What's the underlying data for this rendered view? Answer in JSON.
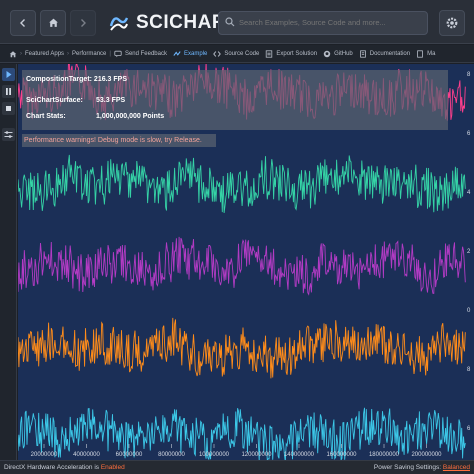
{
  "header": {
    "logo_text": "SCICHART",
    "search_placeholder": "Search Examples, Source Code and more..."
  },
  "breadcrumb": [
    {
      "label": "Featured Apps",
      "icon": "home-icon"
    },
    {
      "label": "Performance",
      "icon": ""
    },
    {
      "label": "Send Feedback",
      "icon": "feedback-icon"
    },
    {
      "label": "Example",
      "icon": "chart-icon",
      "active": true
    },
    {
      "label": "Source Code",
      "icon": "code-icon"
    },
    {
      "label": "Export Solution",
      "icon": "export-icon"
    },
    {
      "label": "GitHub",
      "icon": "github-icon"
    },
    {
      "label": "Documentation",
      "icon": "doc-icon"
    },
    {
      "label": "Ma",
      "icon": "file-icon"
    }
  ],
  "stats": {
    "composition_target": "CompositionTarget: 216.3 FPS",
    "surface_label": "SciChartSurface:",
    "surface_value": "53.3 FPS",
    "points_label": "Chart Stats:",
    "points_value": "1,000,000,000 Points"
  },
  "warning": "Performance warnings! Debug mode is slow, try Release.",
  "chart_data": {
    "type": "line",
    "x_ticks": [
      "20000000",
      "40000000",
      "60000000",
      "80000000",
      "100000000",
      "120000000",
      "140000000",
      "160000000",
      "180000000",
      "200000000"
    ],
    "y_ticks": [
      "8",
      "6",
      "4",
      "2",
      "0",
      "8",
      "6"
    ],
    "series": [
      {
        "color": "#ff3f8c"
      },
      {
        "color": "#35d3a6"
      },
      {
        "color": "#b23bc4"
      },
      {
        "color": "#ff8c1a"
      },
      {
        "color": "#3cc8e8"
      }
    ]
  },
  "status": {
    "left_label": "DirectX Hardware Acceleration is",
    "left_value": "Enabled",
    "right_label": "Power Saving Settings:",
    "right_value": "Balanced"
  },
  "colors": {
    "chart_bg": "#1b2f57",
    "accent": "#6fb8ff",
    "warning": "#f2a39a"
  }
}
